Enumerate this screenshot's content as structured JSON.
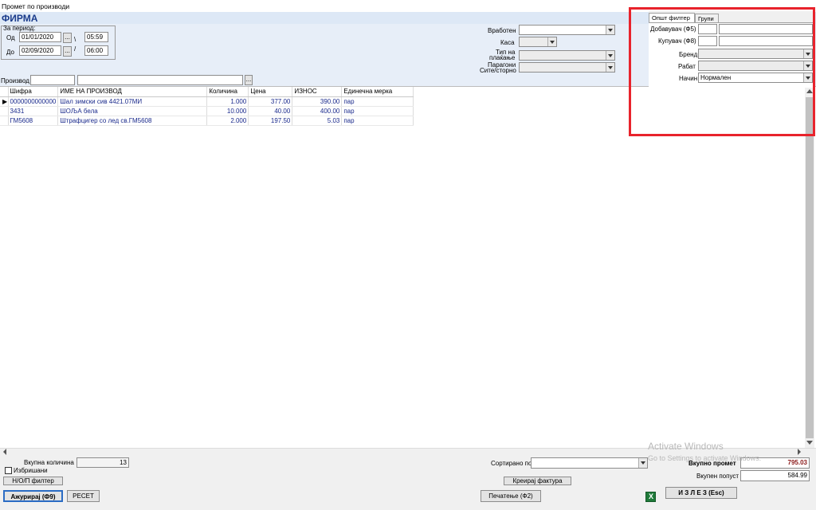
{
  "window": {
    "title": "Промет по производи"
  },
  "company": "ФИРМА",
  "period": {
    "label": "За период:",
    "from_label": "Од",
    "from_date": "01/01/2020",
    "from_time": "05:59",
    "to_label": "До",
    "to_date": "02/09/2020",
    "to_time": "06:00",
    "picker_label": "..."
  },
  "filters": {
    "employee_label": "Вработен",
    "employee_value": "",
    "cash_label": "Каса",
    "cash_value": "",
    "payment_label_1": "Тип на",
    "payment_label_2": "плаќање",
    "payment_value": "",
    "receipts_label_1": "Парагони",
    "receipts_label_2": "Сите/сторно",
    "receipts_value": ""
  },
  "product": {
    "label": "Производ",
    "code": "",
    "name": "",
    "picker_label": "..."
  },
  "filter_panel": {
    "tabs": [
      "Општ филтер",
      "Групи"
    ],
    "supplier_label": "Добавувач (Ф5)",
    "supplier_code": "",
    "supplier_name": "",
    "buyer_label": "Купувач (Ф8)",
    "buyer_code": "",
    "buyer_name": "",
    "brand_label": "Бренд",
    "brand_value": "",
    "discount_label": "Рабат",
    "discount_value": "",
    "mode_label": "Начин",
    "mode_value": "Нормален"
  },
  "table": {
    "columns": [
      "Шифра",
      "ИМЕ НА ПРОИЗВОД",
      "Количина",
      "Цена",
      "ИЗНОС",
      "Единечна мерка"
    ],
    "rows": [
      [
        "0000000000000",
        "Шал зимски сив 4421.07МИ",
        "1.000",
        "377.00",
        "390.00",
        "пар"
      ],
      [
        "3431",
        "ШОЉА бела",
        "10.000",
        "40.00",
        "400.00",
        "пар"
      ],
      [
        "ГМ5608",
        "Штрафцигер со лед св.ГМ5608",
        "2.000",
        "197.50",
        "5.03",
        "пар"
      ]
    ]
  },
  "bottom": {
    "total_qty_label": "Вкупна количина",
    "total_qty_value": "13",
    "deleted_label": "Избришани",
    "nop_filter_label": "Н/О/П филтер",
    "update_label": "Ажурирај (Ф9)",
    "reset_label": "РЕСЕТ",
    "sort_label": "Сортирано по",
    "sort_value": "",
    "create_invoice_label": "Креирај фактура",
    "print_label": "Печатење (Ф2)",
    "total_turnover_label": "Вкупно промет",
    "total_turnover_value": "795.03",
    "total_discount_label": "Вкупен попуст",
    "total_discount_value": "584.99",
    "exit_label": "И З Л Е З (Esc)"
  },
  "watermark": {
    "line1": "Activate Windows",
    "line2": "Go to Settings to activate Windows."
  },
  "colors": {
    "company_text": "#1a3b8b",
    "highlight_box": "#e8232c",
    "turnover_value": "#8b1a1a",
    "row_text": "#1a2a8c"
  }
}
